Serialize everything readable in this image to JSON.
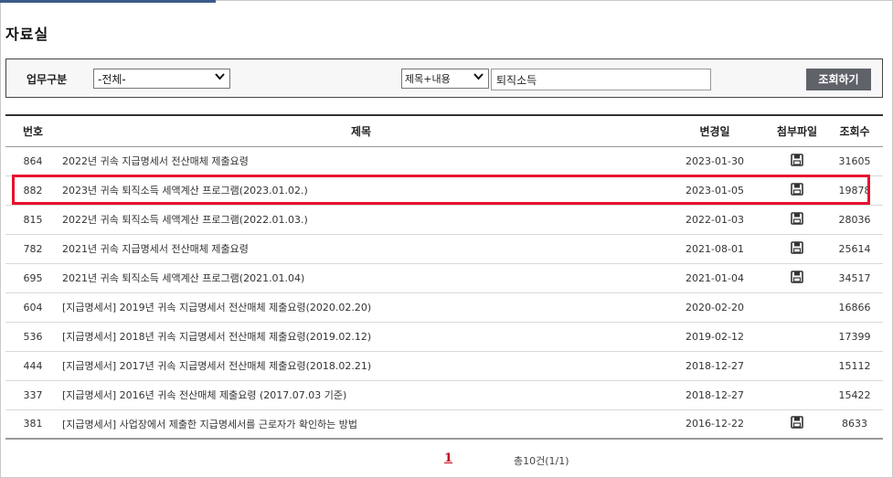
{
  "page": {
    "title": "자료실"
  },
  "search": {
    "category_label": "업무구분",
    "category_selected": "-전체-",
    "field_selected": "제목+내용",
    "keyword_value": "퇴직소득",
    "submit_label": "조회하기"
  },
  "table": {
    "headers": {
      "no": "번호",
      "title": "제목",
      "date": "변경일",
      "attachment": "첨부파일",
      "views": "조회수"
    },
    "rows": [
      {
        "no": "864",
        "title": "2022년 귀속 지급명세서 전산매체 제출요령",
        "date": "2023-01-30",
        "has_file": true,
        "views": "31605"
      },
      {
        "no": "882",
        "title": "2023년 귀속 퇴직소득 세액계산 프로그램(2023.01.02.)",
        "date": "2023-01-05",
        "has_file": true,
        "views": "19878"
      },
      {
        "no": "815",
        "title": "2022년 귀속 퇴직소득 세액계산 프로그램(2022.01.03.)",
        "date": "2022-01-03",
        "has_file": true,
        "views": "28036"
      },
      {
        "no": "782",
        "title": "2021년 귀속 지급명세서 전산매체 제출요령",
        "date": "2021-08-01",
        "has_file": true,
        "views": "25614"
      },
      {
        "no": "695",
        "title": "2021년 귀속 퇴직소득 세액계산 프로그램(2021.01.04)",
        "date": "2021-01-04",
        "has_file": true,
        "views": "34517"
      },
      {
        "no": "604",
        "title": "[지급명세서] 2019년 귀속 지급명세서 전산매체 제출요령(2020.02.20)",
        "date": "2020-02-20",
        "has_file": false,
        "views": "16866"
      },
      {
        "no": "536",
        "title": "[지급명세서] 2018년 귀속 지급명세서 전산매체 제출요령(2019.02.12)",
        "date": "2019-02-12",
        "has_file": false,
        "views": "17399"
      },
      {
        "no": "444",
        "title": "[지급명세서] 2017년 귀속 지급명세서 전산매체 제출요령(2018.02.21)",
        "date": "2018-12-27",
        "has_file": false,
        "views": "15112"
      },
      {
        "no": "337",
        "title": "[지급명세서] 2016년 귀속 전산매체 제출요령 (2017.07.03 기준)",
        "date": "2018-12-27",
        "has_file": false,
        "views": "15422"
      },
      {
        "no": "381",
        "title": "[지급명세서] 사업장에서 제출한 지급명세서를 근로자가 확인하는 방법",
        "date": "2016-12-22",
        "has_file": true,
        "views": "8633"
      }
    ]
  },
  "pagination": {
    "current_page": "1",
    "total_text": "총10건(1/1)"
  },
  "highlight": {
    "row_no": "882",
    "color": "#e8112d"
  },
  "icons": {
    "attachment": "floppy-disk-icon"
  }
}
